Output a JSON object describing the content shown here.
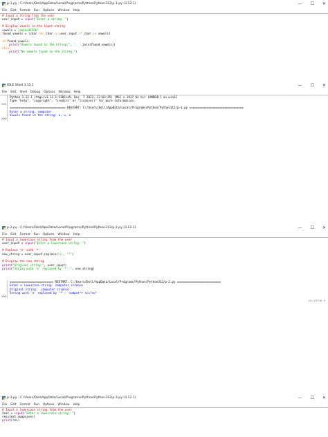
{
  "window1": {
    "title": "p-1.py - C:/Users/Dell/AppData/Local/Programs/Python/Python312/p-1.py (3.12.1)",
    "menu": [
      "File",
      "Edit",
      "Format",
      "Run",
      "Options",
      "Window",
      "Help"
    ],
    "code": [
      {
        "t": "# Input a string from the user",
        "c": "com"
      },
      {
        "t": "user_input = input(\"Enter a string: \")",
        "c": "mix1"
      },
      {
        "t": "",
        "c": "def"
      },
      {
        "t": "# Display vowels in the input string",
        "c": "com"
      },
      {
        "t": "vowels = \"aeiouAEIOU\"",
        "c": "mix2"
      },
      {
        "t": "found_vowels = [char for char in user_input if char in vowels]",
        "c": "mix3"
      },
      {
        "t": "",
        "c": "def"
      },
      {
        "t": "if found_vowels:",
        "c": "mix4"
      },
      {
        "t": "    print(\"Vowels found in the string:\", ', '.join(found_vowels))",
        "c": "mix5"
      },
      {
        "t": "else:",
        "c": "kw"
      },
      {
        "t": "    print(\"No vowels found in the string.\")",
        "c": "mix6"
      }
    ]
  },
  "window2": {
    "title": "IDLE Shell 3.12.1",
    "menu": [
      "File",
      "Edit",
      "Shell",
      "Debug",
      "Options",
      "Window",
      "Help"
    ],
    "lines": [
      {
        "p": "",
        "t": "Python 3.12.1 (tags/v3.12.1:2305ca5, Dec  7 2023, 22:03:25) [MSC v.1937 64 bit (AMD64)] on win32",
        "c": "blk"
      },
      {
        "p": "",
        "t": "Type \"help\", \"copyright\", \"credits\" or \"license()\" for more information.",
        "c": "blk"
      },
      {
        "p": ">>>",
        "t": "",
        "c": "blk"
      },
      {
        "p": "",
        "t": "================================ RESTART: C:/Users/Dell/AppData/Local/Programs/Python/Python312/p-1.py ===============================",
        "c": "blk"
      },
      {
        "p": "",
        "t": "Enter a string: computer",
        "c": "out"
      },
      {
        "p": "",
        "t": "Vowels found in the string: o, u, e",
        "c": "out"
      },
      {
        "p": ">>>",
        "t": "",
        "c": "blk"
      }
    ]
  },
  "window3": {
    "title": "p-2.py - C:/Users/Dell/AppData/Local/Programs/Python/Python312/p-2.py (3.12.1)",
    "menu": [
      "File",
      "Edit",
      "Format",
      "Run",
      "Options",
      "Window",
      "Help"
    ],
    "code": [
      {
        "t": "# Input a lowercase string from the user",
        "c": "com"
      },
      {
        "t": "user_input = input(\"Enter a lowercase string: \")",
        "c": "mix1"
      },
      {
        "t": "",
        "c": "def"
      },
      {
        "t": "# Replace 'e' with '*'",
        "c": "com"
      },
      {
        "t": "new_string = user_input.replace('e', '*')",
        "c": "mix7"
      },
      {
        "t": "",
        "c": "def"
      },
      {
        "t": "# Display the new string",
        "c": "com"
      },
      {
        "t": "print(\"Original string:\", user_input)",
        "c": "mix6"
      },
      {
        "t": "print(\"String with 'e' replaced by '*':\", new_string)",
        "c": "mix6"
      }
    ]
  },
  "window3_shell": {
    "lines": [
      {
        "p": "",
        "t": "========================= RESTART: C:/Users/Dell/AppData/Local/Programs/Python/Python312/p-2.py =========================",
        "c": "blk"
      },
      {
        "p": "",
        "t": "Enter a lowercase string: computer science",
        "c": "out"
      },
      {
        "p": "",
        "t": "Original string:  computer science",
        "c": "out"
      },
      {
        "p": "",
        "t": "String with 'e' replaced by '*':  comput*r sci*nc*",
        "c": "out"
      },
      {
        "p": ">>>",
        "t": "",
        "c": "blk"
      }
    ],
    "status": "Ln: 15  Col: 0"
  },
  "window4": {
    "title": "p-3.py - C:/Users/Dell/AppData/Local/Programs/Python/Python312/p-3.py (3.12.1)",
    "menu": [
      "File",
      "Edit",
      "Format",
      "Run",
      "Options",
      "Window",
      "Help"
    ],
    "code": [
      {
        "t": "# Input a lowercase string from the user",
        "c": "com"
      },
      {
        "t": "text = input(\"Enter a lowercase string: \")",
        "c": "mix1"
      },
      {
        "t": "res=text.swapcase()",
        "c": "def"
      },
      {
        "t": "print(res)",
        "c": "mix6"
      }
    ]
  },
  "controls": {
    "minimize": "—",
    "maximize": "☐",
    "close": "✕"
  }
}
